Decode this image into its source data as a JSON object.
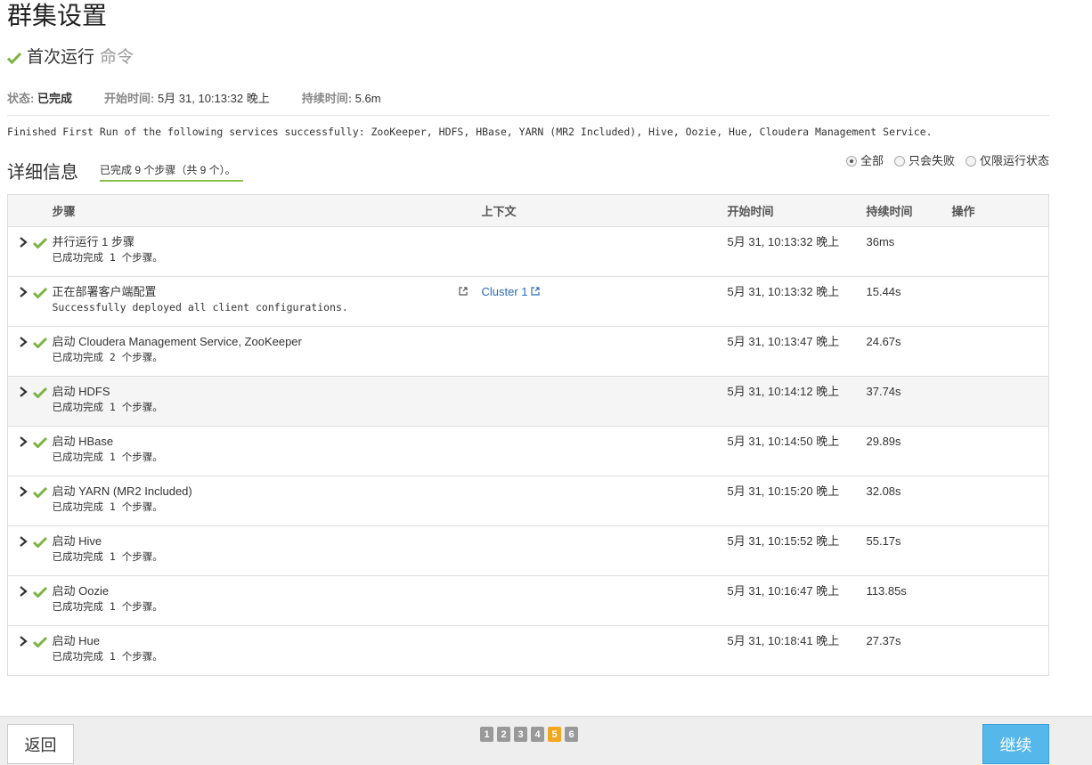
{
  "title": "群集设置",
  "command": {
    "name": "首次运行",
    "suffix": "命令"
  },
  "meta": {
    "status_label": "状态:",
    "status_value": "已完成",
    "start_label": "开始时间:",
    "start_value": "5月 31, 10:13:32 晚上",
    "duration_label": "持续时间:",
    "duration_value": "5.6m"
  },
  "result_message": "Finished First Run of the following services successfully: ZooKeeper, HDFS, HBase, YARN (MR2 Included), Hive, Oozie, Hue, Cloudera Management Service.",
  "details": {
    "heading": "详细信息",
    "progress": "已完成 9 个步骤（共 9 个）。",
    "filters": [
      {
        "label": "全部",
        "selected": true
      },
      {
        "label": "只会失败",
        "selected": false
      },
      {
        "label": "仅限运行状态",
        "selected": false
      }
    ]
  },
  "table": {
    "headers": {
      "step": "步骤",
      "context": "上下文",
      "start": "开始时间",
      "duration": "持续时间",
      "actions": "操作"
    },
    "rows": [
      {
        "name": "并行运行 1 步骤",
        "desc": "已成功完成 1 个步骤。",
        "context": "",
        "start": "5月 31, 10:13:32 晚上",
        "duration": "36ms"
      },
      {
        "name": "正在部署客户端配置",
        "desc": "Successfully deployed all client configurations.",
        "context": "Cluster 1",
        "start": "5月 31, 10:13:32 晚上",
        "duration": "15.44s"
      },
      {
        "name": "启动 Cloudera Management Service, ZooKeeper",
        "desc": "已成功完成 2 个步骤。",
        "context": "",
        "start": "5月 31, 10:13:47 晚上",
        "duration": "24.67s"
      },
      {
        "name": "启动 HDFS",
        "desc": "已成功完成 1 个步骤。",
        "context": "",
        "start": "5月 31, 10:14:12 晚上",
        "duration": "37.74s"
      },
      {
        "name": "启动 HBase",
        "desc": "已成功完成 1 个步骤。",
        "context": "",
        "start": "5月 31, 10:14:50 晚上",
        "duration": "29.89s"
      },
      {
        "name": "启动 YARN (MR2 Included)",
        "desc": "已成功完成 1 个步骤。",
        "context": "",
        "start": "5月 31, 10:15:20 晚上",
        "duration": "32.08s"
      },
      {
        "name": "启动 Hive",
        "desc": "已成功完成 1 个步骤。",
        "context": "",
        "start": "5月 31, 10:15:52 晚上",
        "duration": "55.17s"
      },
      {
        "name": "启动 Oozie",
        "desc": "已成功完成 1 个步骤。",
        "context": "",
        "start": "5月 31, 10:16:47 晚上",
        "duration": "113.85s"
      },
      {
        "name": "启动 Hue",
        "desc": "已成功完成 1 个步骤。",
        "context": "",
        "start": "5月 31, 10:18:41 晚上",
        "duration": "27.37s"
      }
    ]
  },
  "footer": {
    "back_label": "返回",
    "next_label": "继续",
    "pages": [
      "1",
      "2",
      "3",
      "4",
      "5",
      "6"
    ],
    "current_page": "5"
  },
  "colors": {
    "check": "#7cb342",
    "accent": "#55b7ea",
    "current_page": "#f2a81e",
    "link": "#2a6bb8"
  }
}
